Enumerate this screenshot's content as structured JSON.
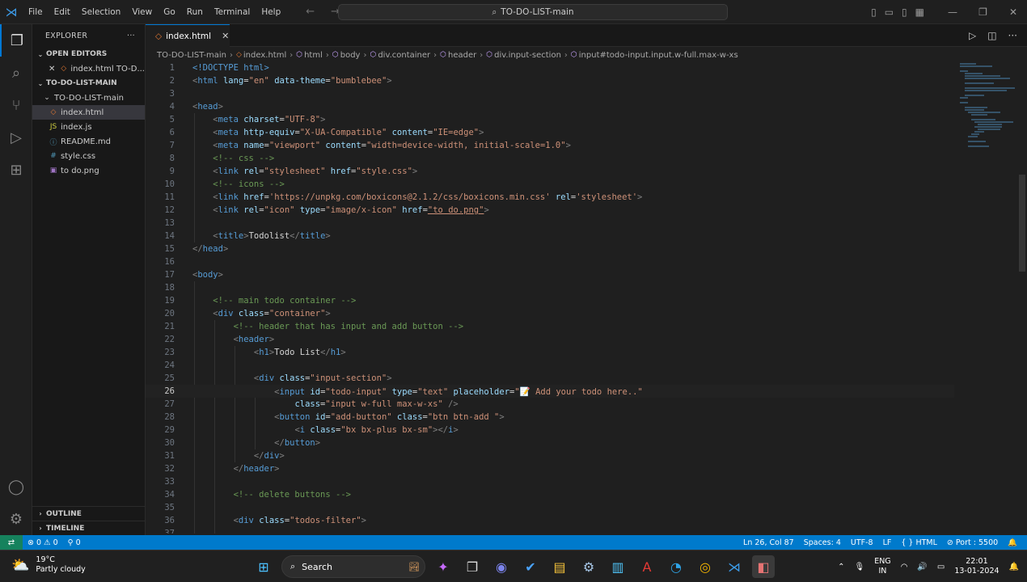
{
  "titlebar": {
    "menu": [
      "File",
      "Edit",
      "Selection",
      "View",
      "Go",
      "Run",
      "Terminal",
      "Help"
    ],
    "search_text": "TO-DO-LIST-main",
    "icons": [
      "vscode-logo-icon",
      "back-arrow-icon",
      "forward-arrow-icon",
      "search-icon",
      "layout-icon",
      "minimize-icon",
      "maximize-icon",
      "close-icon"
    ]
  },
  "sidebar": {
    "title": "EXPLORER",
    "open_editors_label": "OPEN EDITORS",
    "open_editor_item": "index.html TO-D...",
    "folder_label": "TO-DO-LIST-MAIN",
    "subfolder_label": "TO-DO-LIST-main",
    "files": [
      "index.html",
      "index.js",
      "README.md",
      "style.css",
      "to do.png"
    ],
    "outline_label": "OUTLINE",
    "timeline_label": "TIMELINE"
  },
  "editor": {
    "tab_label": "index.html",
    "breadcrumb": [
      "TO-DO-LIST-main",
      "index.html",
      "html",
      "body",
      "div.container",
      "header",
      "div.input-section",
      "input#todo-input.input.w-full.max-w-xs"
    ]
  },
  "code": {
    "line_numbers": [
      "1",
      "2",
      "3",
      "4",
      "5",
      "6",
      "7",
      "8",
      "9",
      "10",
      "11",
      "12",
      "13",
      "14",
      "15",
      "16",
      "17",
      "18",
      "19",
      "20",
      "21",
      "22",
      "23",
      "24",
      "25",
      "26",
      "27",
      "28",
      "29",
      "30",
      "31",
      "32",
      "33",
      "34",
      "35",
      "36",
      "37"
    ],
    "current_line_index": 25,
    "l1": "<!DOCTYPE html>",
    "l2_tag": "html",
    "l2_attr": "lang",
    "l2_val": "\"en\"",
    "l2_attr2": "data-theme",
    "l2_val2": "\"bumblebee\"",
    "l4_tag": "head",
    "l5_tag": "meta",
    "l5_attr": "charset",
    "l5_val": "\"UTF-8\"",
    "l6_tag": "meta",
    "l6_attr": "http-equiv",
    "l6_val": "\"X-UA-Compatible\"",
    "l6_attr2": "content",
    "l6_val2": "\"IE=edge\"",
    "l7_tag": "meta",
    "l7_attr": "name",
    "l7_val": "\"viewport\"",
    "l7_attr2": "content",
    "l7_val2": "\"width=device-width, initial-scale=1.0\"",
    "l8_comment": "<!-- css -->",
    "l9_tag": "link",
    "l9_attr": "rel",
    "l9_val": "\"stylesheet\"",
    "l9_attr2": "href",
    "l9_val2": "\"style.css\"",
    "l10_comment": "<!-- icons -->",
    "l11_tag": "link",
    "l11_attr": "href",
    "l11_val": "'https://unpkg.com/boxicons@2.1.2/css/boxicons.min.css'",
    "l11_attr2": "rel",
    "l11_val2": "'stylesheet'",
    "l12_tag": "link",
    "l12_attr": "rel",
    "l12_val": "\"icon\"",
    "l12_attr2": "type",
    "l12_val2": "\"image/x-icon\"",
    "l12_attr3": "href",
    "l12_val3": "\"to do.png\"",
    "l14_tag": "title",
    "l14_text": "Todolist",
    "l15_tag": "head",
    "l17_tag": "body",
    "l19_comment": "<!-- main todo container -->",
    "l20_tag": "div",
    "l20_attr": "class",
    "l20_val": "\"container\"",
    "l21_comment": "<!-- header that has input and add button -->",
    "l22_tag": "header",
    "l23_tag": "h1",
    "l23_text": "Todo List",
    "l25_tag": "div",
    "l25_attr": "class",
    "l25_val": "\"input-section\"",
    "l26_tag": "input",
    "l26_attr": "id",
    "l26_val": "\"todo-input\"",
    "l26_attr2": "type",
    "l26_val2": "\"text\"",
    "l26_attr3": "placeholder",
    "l26_val3": "\"📝 Add your todo here..\"",
    "l27_attr": "class",
    "l27_val": "\"input w-full max-w-xs\"",
    "l28_tag": "button",
    "l28_attr": "id",
    "l28_val": "\"add-button\"",
    "l28_attr2": "class",
    "l28_val2": "\"btn btn-add \"",
    "l29_tag": "i",
    "l29_attr": "class",
    "l29_val": "\"bx bx-plus bx-sm\"",
    "l30_tag": "button",
    "l31_tag": "div",
    "l32_tag": "header",
    "l34_comment": "<!-- delete buttons -->",
    "l36_tag": "div",
    "l36_attr": "class",
    "l36_val": "\"todos-filter\""
  },
  "statusbar": {
    "errors": "0",
    "warnings": "0",
    "ports": "0",
    "position": "Ln 26, Col 87",
    "spaces": "Spaces: 4",
    "encoding": "UTF-8",
    "eol": "LF",
    "language": "HTML",
    "port": "Port : 5500"
  },
  "taskbar": {
    "temp": "19°C",
    "weather": "Partly cloudy",
    "search_label": "Search",
    "lang1": "ENG",
    "lang2": "IN",
    "time": "22:01",
    "date": "13-01-2024"
  },
  "colors": {
    "accent": "#007acc",
    "background": "#1f1f1f",
    "sidebar": "#181818"
  }
}
